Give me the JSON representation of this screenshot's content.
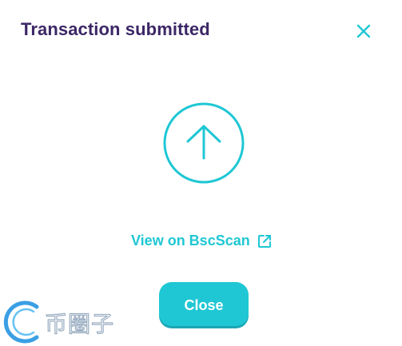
{
  "modal": {
    "title": "Transaction submitted",
    "link_label": "View on BscScan",
    "close_button_label": "Close"
  },
  "icons": {
    "close": "close-icon",
    "status": "arrow-up-circle-icon",
    "external_link": "external-link-icon"
  },
  "watermark": {
    "text": "币圈子"
  },
  "colors": {
    "title": "#3c2766",
    "accent": "#1fc7d4",
    "button_text": "#ffffff",
    "background": "#ffffff"
  }
}
